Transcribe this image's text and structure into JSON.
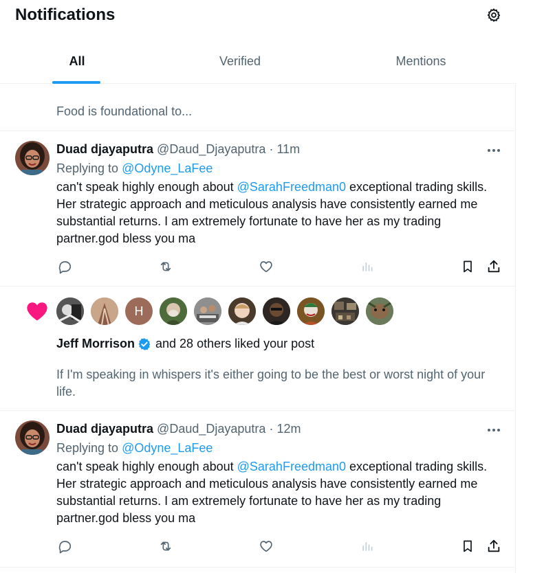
{
  "header": {
    "title": "Notifications",
    "settings_icon": "gear-icon",
    "tabs": [
      {
        "label": "All",
        "active": true
      },
      {
        "label": "Verified",
        "active": false
      },
      {
        "label": "Mentions",
        "active": false
      }
    ],
    "accent": "#1d9bf0"
  },
  "partial_post": {
    "text": "Food is foundational to..."
  },
  "posts": [
    {
      "name": "Duad djayaputra",
      "handle": "@Daud_Djayaputra",
      "separator": "·",
      "time": "11m",
      "replying_prefix": "Replying to",
      "replying_to": "@Odyne_LaFee",
      "body_before": "can't speak highly enough about ",
      "body_mention": "@SarahFreedman0",
      "body_after": " exceptional trading skills. Her strategic approach and meticulous analysis have consistently earned me substantial returns. I am extremely fortunate to have her as my trading partner.god bless you ma"
    },
    {
      "name": "Duad djayaputra",
      "handle": "@Daud_Djayaputra",
      "separator": "·",
      "time": "12m",
      "replying_prefix": "Replying to",
      "replying_to": "@Odyne_LaFee",
      "body_before": "can't speak highly enough about ",
      "body_mention": "@SarahFreedman0",
      "body_after": " exceptional trading skills. Her strategic approach and meticulous analysis have consistently earned me substantial returns. I am extremely fortunate to have her as my trading partner.god bless you ma"
    }
  ],
  "like_notification": {
    "heart_color": "#f91880",
    "avatar_initial": "H",
    "liker_name": "Jeff Morrison",
    "liker_rest": "and 28 others liked your post",
    "post_text": "If I'm speaking in whispers it's either going to be the best or worst night of your life."
  }
}
